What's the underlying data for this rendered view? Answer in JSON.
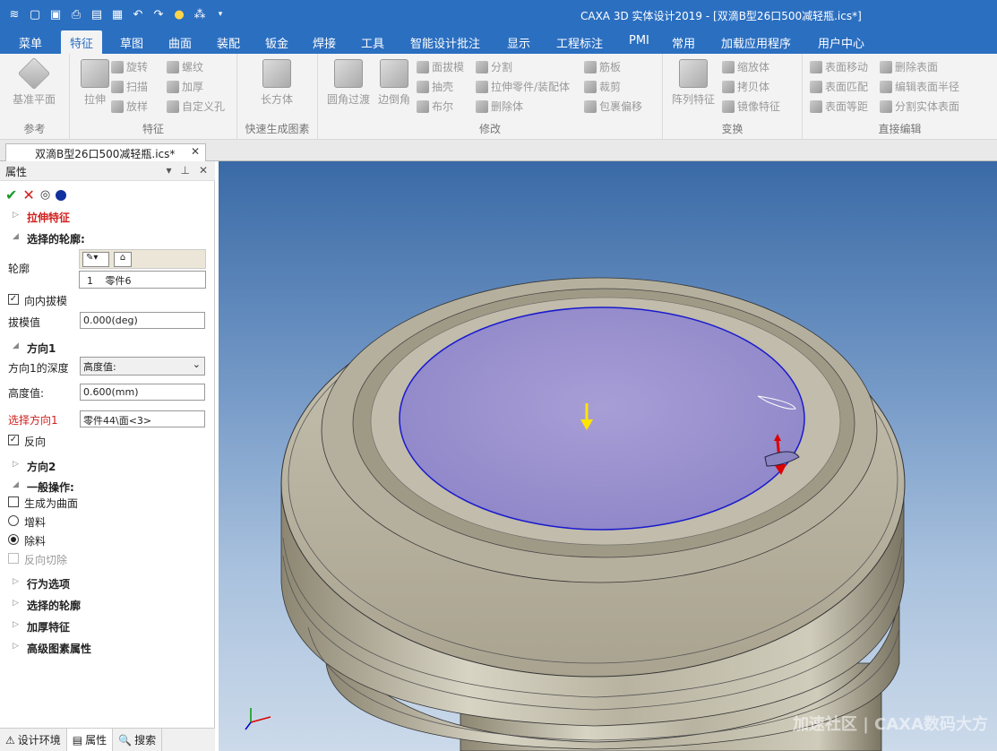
{
  "window_title": "CAXA 3D 实体设计2019 - [双滴B型26口500减轻瓶.ics*]",
  "quick_access": [
    "app-icon",
    "new-icon",
    "open-icon",
    "save-icon",
    "undo-icon",
    "redo-icon",
    "help-icon"
  ],
  "menu": [
    "菜单",
    "特征",
    "草图",
    "曲面",
    "装配",
    "钣金",
    "焊接",
    "工具",
    "智能设计批注",
    "显示",
    "工程标注",
    "PMI",
    "常用",
    "加载应用程序",
    "用户中心"
  ],
  "ribbon": {
    "groups": {
      "ref": "参考",
      "feature": "特征",
      "quick": "快速生成图素",
      "modify": "修改",
      "transform": "变换",
      "direct": "直接编辑"
    },
    "ref_plane": "基准平面",
    "extrude": "拉伸",
    "rotate": "旋转",
    "sweep": "扫描",
    "loft": "放样",
    "thread": "螺纹",
    "thicken": "加厚",
    "custom_hole": "自定义孔",
    "box": "长方体",
    "fillet": "圆角过渡",
    "chamfer": "边倒角",
    "face_draft": "面拔模",
    "shell": "抽壳",
    "boolean": "布尔",
    "split": "分割",
    "extrude_part": "拉伸零件/装配体",
    "delete_body": "删除体",
    "rib": "筋板",
    "trim": "裁剪",
    "wrap_offset": "包裹偏移",
    "pattern": "阵列特征",
    "scale": "缩放体",
    "copy": "拷贝体",
    "mirror": "镜像特征",
    "face_move": "表面移动",
    "face_match": "表面匹配",
    "face_equidist": "表面等距",
    "delete_face": "删除表面",
    "edit_radius": "编辑表面半径",
    "split_solid": "分割实体表面"
  },
  "doc_tab": "双滴B型26口500减轻瓶.ics*",
  "panel": {
    "title": "属性",
    "extrude_feature": "拉伸特征",
    "selected_profile": "选择的轮廓:",
    "profile_label": "轮廓",
    "profile_item_index": "1",
    "profile_item": "零件6",
    "draft_inward": "向内拔模",
    "draft_value_label": "拔模值",
    "draft_value": "0.000(deg)",
    "dir1": "方向1",
    "dir1_depth_label": "方向1的深度",
    "dir1_depth": "高度值:",
    "height_label": "高度值:",
    "height_value": "0.600(mm)",
    "select_dir1": "选择方向1",
    "select_dir1_value": "零件44\\面<3>",
    "reverse": "反向",
    "dir2": "方向2",
    "general_ops": "一般操作:",
    "gen_surface": "生成为曲面",
    "add_material": "增料",
    "remove_material": "除料",
    "reverse_cut": "反向切除",
    "behavior": "行为选项",
    "sel_profile": "选择的轮廓",
    "thicken_feature": "加厚特征",
    "advanced": "高级图素属性"
  },
  "bottom_tabs": [
    "设计环境",
    "属性",
    "搜索"
  ],
  "watermark": "加速社区 | CAXA数码大方"
}
